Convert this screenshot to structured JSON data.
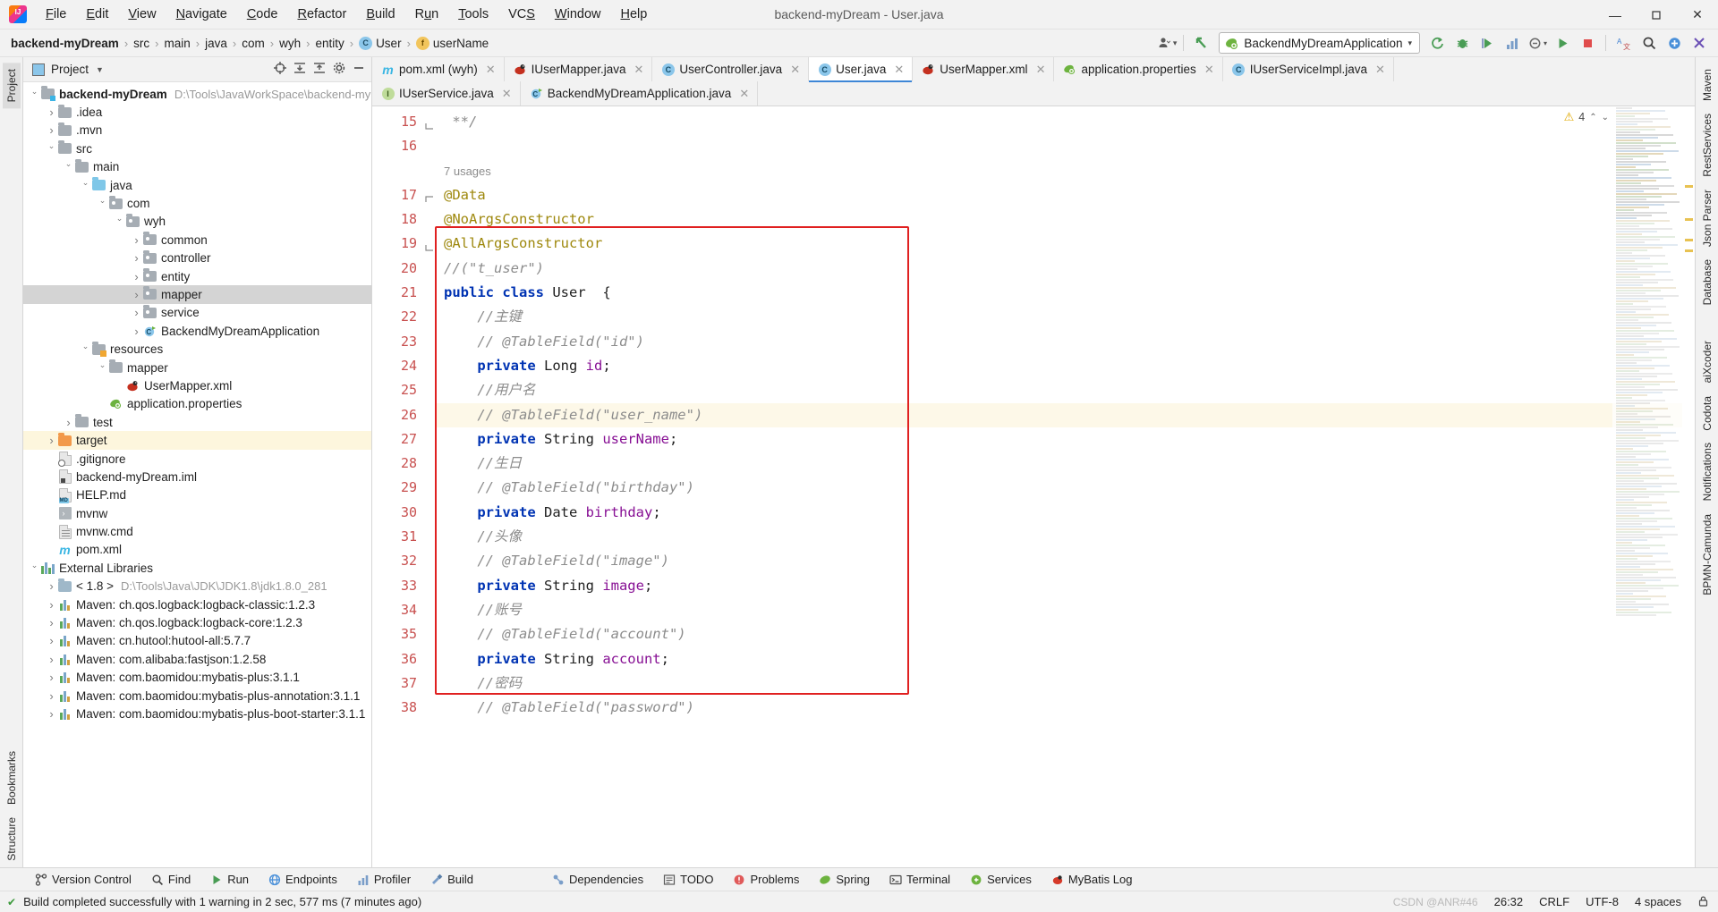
{
  "window": {
    "title": "backend-myDream - User.java",
    "app_icon": "intellij-idea-logo",
    "controls": {
      "minimize": "—",
      "maximize": "▢",
      "close": "✕"
    }
  },
  "menubar": [
    {
      "label": "File"
    },
    {
      "label": "Edit"
    },
    {
      "label": "View"
    },
    {
      "label": "Navigate"
    },
    {
      "label": "Code"
    },
    {
      "label": "Refactor"
    },
    {
      "label": "Build"
    },
    {
      "label": "Run"
    },
    {
      "label": "Tools"
    },
    {
      "label": "VCS"
    },
    {
      "label": "Window"
    },
    {
      "label": "Help"
    }
  ],
  "breadcrumb": [
    {
      "label": "backend-myDream",
      "icon": "",
      "bold": true
    },
    {
      "label": "src",
      "icon": ""
    },
    {
      "label": "main",
      "icon": ""
    },
    {
      "label": "java",
      "icon": ""
    },
    {
      "label": "com",
      "icon": ""
    },
    {
      "label": "wyh",
      "icon": ""
    },
    {
      "label": "entity",
      "icon": ""
    },
    {
      "label": "User",
      "icon": "class-icon"
    },
    {
      "label": "userName",
      "icon": "field-icon"
    }
  ],
  "toolbar": {
    "run_config": "BackendMyDreamApplication",
    "icons": [
      "user-avatar-icon",
      "back-arrow-icon",
      "build-refresh-icon",
      "debug-icon",
      "run-with-coverage-icon",
      "profiler-icon",
      "attach-icon",
      "run-icon",
      "stop-icon",
      "translate-icon",
      "search-icon",
      "plugins-icon",
      "settings-icon"
    ]
  },
  "project_panel": {
    "title": "Project",
    "header_icons": [
      "target-icon",
      "collapse-all-icon",
      "expand-icon",
      "gear-icon",
      "hide-icon"
    ],
    "tree": [
      {
        "depth": 0,
        "arrow": "open",
        "icon": "module-folder",
        "label": "backend-myDream",
        "bold": true,
        "sub": "D:\\Tools\\JavaWorkSpace\\backend-my"
      },
      {
        "depth": 1,
        "arrow": "closed",
        "icon": "folder-gray",
        "label": ".idea"
      },
      {
        "depth": 1,
        "arrow": "closed",
        "icon": "folder-gray",
        "label": ".mvn"
      },
      {
        "depth": 1,
        "arrow": "open",
        "icon": "folder-gray",
        "label": "src"
      },
      {
        "depth": 2,
        "arrow": "open",
        "icon": "folder-gray",
        "label": "main"
      },
      {
        "depth": 3,
        "arrow": "open",
        "icon": "folder-source",
        "label": "java"
      },
      {
        "depth": 4,
        "arrow": "open",
        "icon": "package",
        "label": "com"
      },
      {
        "depth": 5,
        "arrow": "open",
        "icon": "package",
        "label": "wyh"
      },
      {
        "depth": 6,
        "arrow": "closed",
        "icon": "package",
        "label": "common"
      },
      {
        "depth": 6,
        "arrow": "closed",
        "icon": "package",
        "label": "controller"
      },
      {
        "depth": 6,
        "arrow": "closed",
        "icon": "package",
        "label": "entity"
      },
      {
        "depth": 6,
        "arrow": "closed",
        "icon": "package",
        "label": "mapper",
        "selected": true
      },
      {
        "depth": 6,
        "arrow": "closed",
        "icon": "package",
        "label": "service"
      },
      {
        "depth": 6,
        "arrow": "closed",
        "icon": "spring-class",
        "label": "BackendMyDreamApplication"
      },
      {
        "depth": 3,
        "arrow": "open",
        "icon": "folder-res",
        "label": "resources"
      },
      {
        "depth": 4,
        "arrow": "open",
        "icon": "folder-gray",
        "label": "mapper"
      },
      {
        "depth": 5,
        "arrow": "none",
        "icon": "mybatis",
        "label": "UserMapper.xml"
      },
      {
        "depth": 4,
        "arrow": "none",
        "icon": "spring-prop",
        "label": "application.properties"
      },
      {
        "depth": 2,
        "arrow": "closed",
        "icon": "folder-gray",
        "label": "test"
      },
      {
        "depth": 1,
        "arrow": "closed",
        "icon": "folder-orange",
        "label": "target",
        "highlight": true
      },
      {
        "depth": 1,
        "arrow": "none",
        "icon": "file-git",
        "label": ".gitignore"
      },
      {
        "depth": 1,
        "arrow": "none",
        "icon": "file-iml",
        "label": "backend-myDream.iml"
      },
      {
        "depth": 1,
        "arrow": "none",
        "icon": "file-md",
        "label": "HELP.md"
      },
      {
        "depth": 1,
        "arrow": "none",
        "icon": "file-exec",
        "label": "mvnw"
      },
      {
        "depth": 1,
        "arrow": "none",
        "icon": "file-plain",
        "label": "mvnw.cmd"
      },
      {
        "depth": 1,
        "arrow": "none",
        "icon": "maven-m",
        "label": "pom.xml"
      },
      {
        "depth": 0,
        "arrow": "open",
        "icon": "libraries",
        "label": "External Libraries"
      },
      {
        "depth": 1,
        "arrow": "closed",
        "icon": "jdk",
        "label": "< 1.8 >",
        "sub": "D:\\Tools\\Java\\JDK\\JDK1.8\\jdk1.8.0_281"
      },
      {
        "depth": 1,
        "arrow": "closed",
        "icon": "maven-lib",
        "label": "Maven: ch.qos.logback:logback-classic:1.2.3"
      },
      {
        "depth": 1,
        "arrow": "closed",
        "icon": "maven-lib",
        "label": "Maven: ch.qos.logback:logback-core:1.2.3"
      },
      {
        "depth": 1,
        "arrow": "closed",
        "icon": "maven-lib",
        "label": "Maven: cn.hutool:hutool-all:5.7.7"
      },
      {
        "depth": 1,
        "arrow": "closed",
        "icon": "maven-lib",
        "label": "Maven: com.alibaba:fastjson:1.2.58"
      },
      {
        "depth": 1,
        "arrow": "closed",
        "icon": "maven-lib",
        "label": "Maven: com.baomidou:mybatis-plus:3.1.1"
      },
      {
        "depth": 1,
        "arrow": "closed",
        "icon": "maven-lib",
        "label": "Maven: com.baomidou:mybatis-plus-annotation:3.1.1"
      },
      {
        "depth": 1,
        "arrow": "closed",
        "icon": "maven-lib",
        "label": "Maven: com.baomidou:mybatis-plus-boot-starter:3.1.1"
      }
    ]
  },
  "editor": {
    "tabs_row1": [
      {
        "label": "pom.xml (wyh)",
        "icon": "maven-m",
        "active": false
      },
      {
        "label": "IUserMapper.java",
        "icon": "mybatis",
        "active": false
      },
      {
        "label": "UserController.java",
        "icon": "class-icon",
        "active": false
      },
      {
        "label": "User.java",
        "icon": "class-icon",
        "active": true
      },
      {
        "label": "UserMapper.xml",
        "icon": "mybatis",
        "active": false
      },
      {
        "label": "application.properties",
        "icon": "spring-prop",
        "active": false
      },
      {
        "label": "IUserServiceImpl.java",
        "icon": "class-icon",
        "active": false
      }
    ],
    "tabs_row2": [
      {
        "label": "IUserService.java",
        "icon": "interface-icon",
        "active": false
      },
      {
        "label": "BackendMyDreamApplication.java",
        "icon": "spring-class",
        "active": false
      }
    ],
    "inspection": {
      "warning_count": "4",
      "icon": "warning-triangle"
    },
    "usages_hint": "7 usages",
    "lines": [
      {
        "n": 15,
        "tokens": [
          {
            "t": "cmt",
            "v": " **/"
          }
        ],
        "fold": "end"
      },
      {
        "n": 16,
        "tokens": []
      },
      {
        "n": "",
        "tokens": [
          {
            "t": "usages",
            "v": "7 usages"
          }
        ],
        "is_hint": true
      },
      {
        "n": 17,
        "tokens": [
          {
            "t": "anno",
            "v": "@Data"
          }
        ],
        "fold": "start"
      },
      {
        "n": 18,
        "tokens": [
          {
            "t": "anno",
            "v": "@NoArgsConstructor"
          }
        ]
      },
      {
        "n": 19,
        "tokens": [
          {
            "t": "anno",
            "v": "@AllArgsConstructor"
          }
        ],
        "fold": "end"
      },
      {
        "n": 20,
        "tokens": [
          {
            "t": "cmt",
            "v": "//(\"t_user\")"
          }
        ]
      },
      {
        "n": 21,
        "tokens": [
          {
            "t": "kw",
            "v": "public class "
          },
          {
            "t": "id",
            "v": "User  {"
          }
        ]
      },
      {
        "n": 22,
        "tokens": [
          {
            "t": "cmt",
            "v": "    //主键"
          }
        ]
      },
      {
        "n": 23,
        "tokens": [
          {
            "t": "cmt",
            "v": "    // @TableField(\"id\")"
          }
        ]
      },
      {
        "n": 24,
        "tokens": [
          {
            "t": "kw",
            "v": "    private "
          },
          {
            "t": "id",
            "v": "Long "
          },
          {
            "t": "fld2",
            "v": "id"
          },
          {
            "t": "id",
            "v": ";"
          }
        ]
      },
      {
        "n": 25,
        "tokens": [
          {
            "t": "cmt",
            "v": "    //用户名"
          }
        ]
      },
      {
        "n": 26,
        "tokens": [
          {
            "t": "cmt",
            "v": "    // @TableField(\"user_name\")"
          }
        ],
        "current": true
      },
      {
        "n": 27,
        "tokens": [
          {
            "t": "kw",
            "v": "    private "
          },
          {
            "t": "id",
            "v": "String "
          },
          {
            "t": "fld2",
            "v": "userName"
          },
          {
            "t": "id",
            "v": ";"
          }
        ]
      },
      {
        "n": 28,
        "tokens": [
          {
            "t": "cmt",
            "v": "    //生日"
          }
        ]
      },
      {
        "n": 29,
        "tokens": [
          {
            "t": "cmt",
            "v": "    // @TableField(\"birthday\")"
          }
        ]
      },
      {
        "n": 30,
        "tokens": [
          {
            "t": "kw",
            "v": "    private "
          },
          {
            "t": "id",
            "v": "Date "
          },
          {
            "t": "fld2",
            "v": "birthday"
          },
          {
            "t": "id",
            "v": ";"
          }
        ]
      },
      {
        "n": 31,
        "tokens": [
          {
            "t": "cmt",
            "v": "    //头像"
          }
        ]
      },
      {
        "n": 32,
        "tokens": [
          {
            "t": "cmt",
            "v": "    // @TableField(\"image\")"
          }
        ]
      },
      {
        "n": 33,
        "tokens": [
          {
            "t": "kw",
            "v": "    private "
          },
          {
            "t": "id",
            "v": "String "
          },
          {
            "t": "fld2",
            "v": "image"
          },
          {
            "t": "id",
            "v": ";"
          }
        ]
      },
      {
        "n": 34,
        "tokens": [
          {
            "t": "cmt",
            "v": "    //账号"
          }
        ]
      },
      {
        "n": 35,
        "tokens": [
          {
            "t": "cmt",
            "v": "    // @TableField(\"account\")"
          }
        ]
      },
      {
        "n": 36,
        "tokens": [
          {
            "t": "kw",
            "v": "    private "
          },
          {
            "t": "id",
            "v": "String "
          },
          {
            "t": "fld2",
            "v": "account"
          },
          {
            "t": "id",
            "v": ";"
          }
        ]
      },
      {
        "n": 37,
        "tokens": [
          {
            "t": "cmt",
            "v": "    //密码"
          }
        ]
      },
      {
        "n": 38,
        "tokens": [
          {
            "t": "cmt",
            "v": "    // @TableField(\"password\")"
          }
        ]
      }
    ]
  },
  "left_rail": [
    {
      "label": "Project",
      "active": true
    },
    {
      "label": "Bookmarks",
      "active": false
    },
    {
      "label": "Structure",
      "active": false
    }
  ],
  "right_rail": [
    {
      "label": "Maven"
    },
    {
      "label": "RestServices"
    },
    {
      "label": "Json Parser"
    },
    {
      "label": "Database"
    },
    {
      "label": "aiXcoder"
    },
    {
      "label": "Codota"
    },
    {
      "label": "Notifications"
    },
    {
      "label": "BPMN-Camunda"
    }
  ],
  "bottom_windows_left": [
    {
      "label": "Version Control",
      "icon": "branch-icon"
    },
    {
      "label": "Find",
      "icon": "search-icon"
    },
    {
      "label": "Run",
      "icon": "run-icon"
    },
    {
      "label": "Endpoints",
      "icon": "endpoints-icon"
    },
    {
      "label": "Profiler",
      "icon": "profiler-icon"
    },
    {
      "label": "Build",
      "icon": "build-icon"
    }
  ],
  "bottom_windows_right": [
    {
      "label": "Dependencies",
      "icon": "dependencies-icon"
    },
    {
      "label": "TODO",
      "icon": "todo-icon"
    },
    {
      "label": "Problems",
      "icon": "problems-icon"
    },
    {
      "label": "Spring",
      "icon": "spring-icon"
    },
    {
      "label": "Terminal",
      "icon": "terminal-icon"
    },
    {
      "label": "Services",
      "icon": "services-icon"
    },
    {
      "label": "MyBatis Log",
      "icon": "mybatis-icon"
    }
  ],
  "statusbar": {
    "message": "Build completed successfully with 1 warning in 2 sec, 577 ms (7 minutes ago)",
    "caret": "26:32",
    "line_sep": "CRLF",
    "encoding": "UTF-8",
    "indent": "4 spaces",
    "lock_icon": "lock-icon",
    "watermark": "CSDN @ANR#46"
  },
  "colors": {
    "accent": "#3e86d6",
    "red_box": "#e02020",
    "keyword": "#0033b3",
    "comment": "#8c8c8c",
    "annotation": "#9e880d",
    "field": "#871094",
    "linenum": "#c8504f",
    "selection": "#d4d4d4",
    "highlight": "#fdf6dd"
  }
}
